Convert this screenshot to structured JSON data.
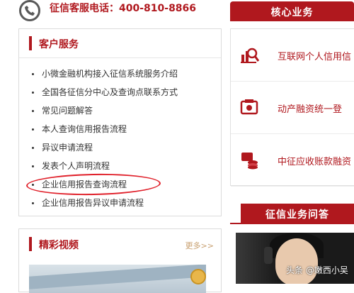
{
  "header": {
    "hotline": "征信客服电话：400-810-8866"
  },
  "service_panel": {
    "title": "客户服务",
    "items": [
      "小微金融机构接入征信系统服务介绍",
      "全国各征信分中心及查询点联系方式",
      "常见问题解答",
      "本人查询信用报告流程",
      "异议申请流程",
      "发表个人声明流程",
      "企业信用报告查询流程",
      "企业信用报告异议申请流程"
    ],
    "highlighted_index": 6
  },
  "video_panel": {
    "title": "精彩视频",
    "more": "更多>>"
  },
  "core_business": {
    "tab_label": "核心业务",
    "items": [
      {
        "icon": "chart-magnifier-icon",
        "label": "互联网个人信用信"
      },
      {
        "icon": "pledge-box-icon",
        "label": "动产融资统一登"
      },
      {
        "icon": "coin-stack-icon",
        "label": "中征应收账款融资"
      }
    ]
  },
  "qa": {
    "tab_label": "征信业务问答"
  },
  "watermark": "头条 @嫩西小吴",
  "colors": {
    "accent": "#b0181e",
    "highlight_ring": "#e0202a"
  }
}
